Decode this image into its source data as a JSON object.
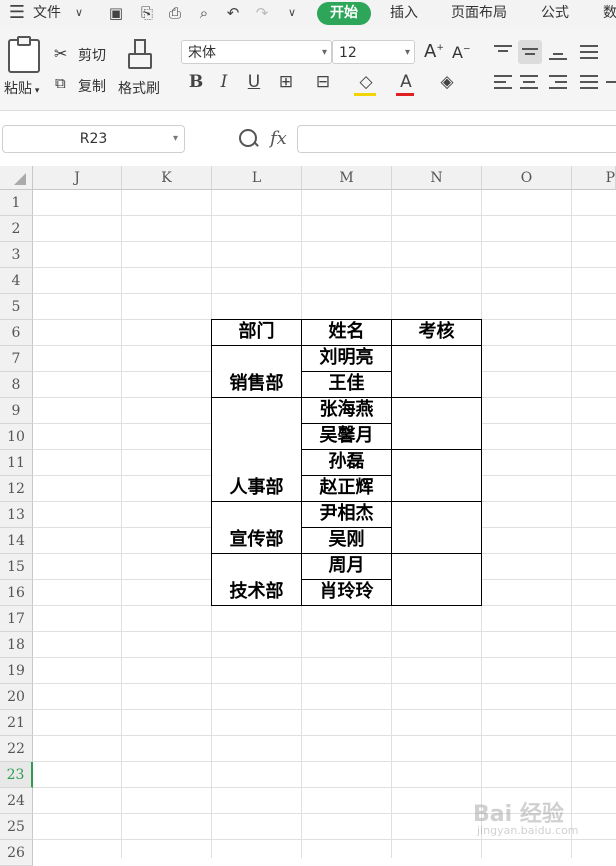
{
  "menubar": {
    "file_label": "文件",
    "tabs": [
      "开始",
      "插入",
      "页面布局",
      "公式",
      "数"
    ],
    "active_tab": "开始"
  },
  "ribbon": {
    "paste": "粘贴",
    "cut": "剪切",
    "copy": "复制",
    "format_painter": "格式刷",
    "font_name": "宋体",
    "font_size": "12"
  },
  "formula_bar": {
    "name_box": "R23",
    "fx": "fx",
    "formula": ""
  },
  "sheet": {
    "columns": [
      "J",
      "K",
      "L",
      "M",
      "N",
      "O",
      "P"
    ],
    "rows": [
      "1",
      "2",
      "3",
      "4",
      "5",
      "6",
      "7",
      "8",
      "9",
      "10",
      "11",
      "12",
      "13",
      "14",
      "15",
      "16",
      "17",
      "18",
      "19",
      "20",
      "21",
      "22",
      "23",
      "24",
      "25",
      "26"
    ],
    "active_row": "23",
    "table": {
      "headers": [
        "部门",
        "姓名",
        "考核"
      ],
      "departments": [
        "销售部",
        "人事部",
        "宣传部",
        "技术部"
      ],
      "names": [
        "刘明亮",
        "王佳",
        "张海燕",
        "吴馨月",
        "孙磊",
        "赵正辉",
        "尹相杰",
        "吴刚",
        "周月",
        "肖玲玲"
      ]
    }
  },
  "watermark": {
    "text": "Bai 经验",
    "sub": "jingyan.baidu.com"
  },
  "colors": {
    "accent": "#2ea65a",
    "active_row": "#2e9b52"
  }
}
